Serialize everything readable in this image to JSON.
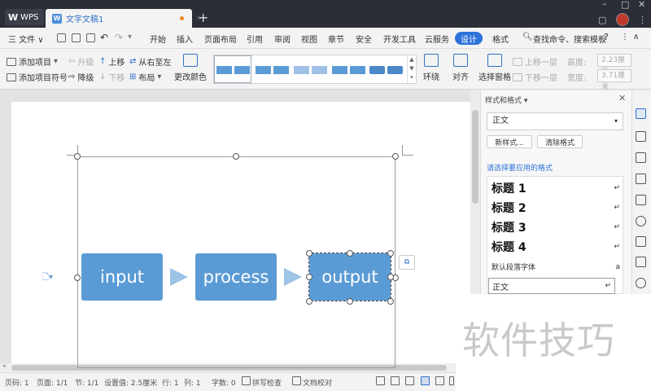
{
  "titlebar": {
    "app_tab": "WPS",
    "doc_tab": "文字文稿1",
    "new_tab": "+"
  },
  "menubar": {
    "file": "三 文件 ∨",
    "items": [
      "开始",
      "插入",
      "页面布局",
      "引用",
      "审阅",
      "视图",
      "章节",
      "安全",
      "开发工具",
      "云服务"
    ],
    "active": "设计",
    "after": "格式",
    "search": "查找命令、搜索模板",
    "help": "?"
  },
  "toolbar": {
    "add_item": "添加项目",
    "add_item_bullet": "添加项目符号",
    "promote": "升级",
    "demote": "降级",
    "move_up": "上移",
    "move_down": "下移",
    "rtl": "从右至左",
    "layout": "布局",
    "change_color": "更改颜色",
    "wrap": "环绕",
    "align": "对齐",
    "selection_pane": "选择窗格",
    "bring_forward": "上移一层",
    "send_backward": "下移一层",
    "height_label": "高度:",
    "height_value": "2.23厘米",
    "width_label": "宽度:",
    "width_value": "3.71厘米"
  },
  "diagram": {
    "boxes": [
      "input",
      "process",
      "output"
    ]
  },
  "panel": {
    "title": "样式和格式",
    "current_style": "正文",
    "new_style": "新样式...",
    "clear_format": "清除格式",
    "apply_label": "请选择要应用的格式",
    "styles": [
      {
        "label": "标题  1",
        "mark": "↵"
      },
      {
        "label": "标题  2",
        "mark": "↵"
      },
      {
        "label": "标题  3",
        "mark": "↵"
      },
      {
        "label": "标题  4",
        "mark": "↵"
      },
      {
        "label": "默认段落字体",
        "mark": "a"
      },
      {
        "label": "正文",
        "mark": "↵"
      }
    ]
  },
  "statusbar": {
    "page_num": "页码: 1",
    "pages": "页面: 1/1",
    "section": "节: 1/1",
    "setting": "设置值: 2.5厘米",
    "row": "行: 1",
    "col": "列: 1",
    "words": "字数: 0",
    "spell": "拼写检查",
    "proof": "文档校对"
  },
  "watermark": "软件技巧",
  "colors": {
    "accent": "#2d72d9",
    "box_fill": "#5b9bd5",
    "titlebar": "#2b2e36"
  }
}
